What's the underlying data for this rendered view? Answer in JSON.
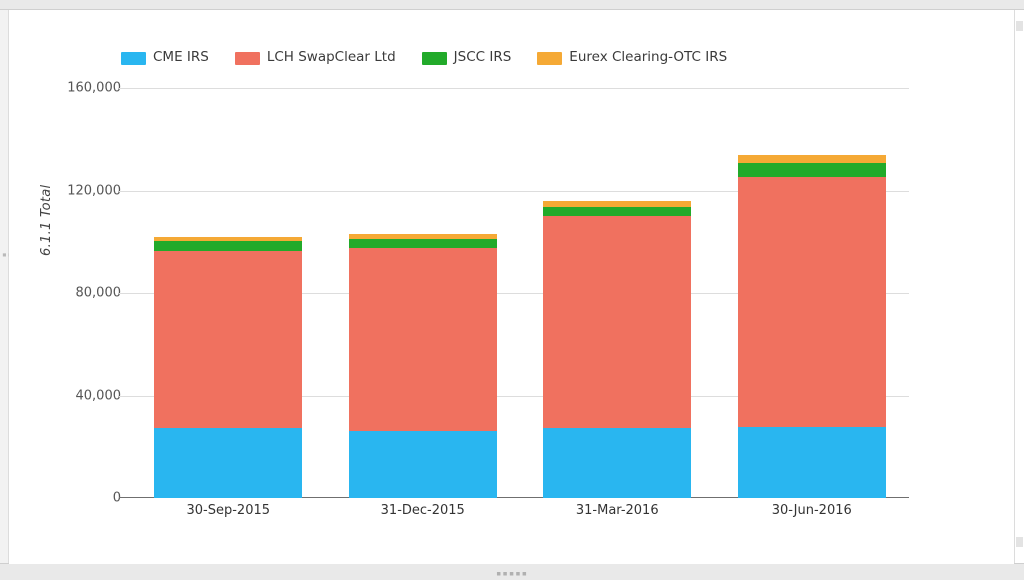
{
  "chart_data": {
    "type": "bar",
    "stacked": true,
    "title": "",
    "xlabel": "",
    "ylabel": "6.1.1 Total",
    "categories": [
      "30-Sep-2015",
      "31-Dec-2015",
      "31-Mar-2016",
      "30-Jun-2016"
    ],
    "ylim": [
      0,
      160000
    ],
    "y_ticks": [
      0,
      40000,
      80000,
      120000,
      160000
    ],
    "y_tick_labels": [
      "0",
      "40,000",
      "80,000",
      "120,000",
      "160,000"
    ],
    "grid": true,
    "legend_position": "top-left",
    "series": [
      {
        "name": "CME IRS",
        "color": "#29b6f0",
        "values": [
          27200,
          26000,
          27200,
          27600
        ]
      },
      {
        "name": "LCH SwapClear Ltd",
        "color": "#f0715f",
        "values": [
          69200,
          71600,
          82800,
          97600
        ]
      },
      {
        "name": "JSCC IRS",
        "color": "#22aa2a",
        "values": [
          4000,
          3600,
          3600,
          5600
        ]
      },
      {
        "name": "Eurex Clearing-OTC IRS",
        "color": "#f5a935",
        "values": [
          1600,
          2000,
          2400,
          3200
        ]
      }
    ],
    "totals": [
      102000,
      103200,
      116000,
      134000
    ]
  },
  "legend": {
    "items": [
      {
        "label": "CME IRS",
        "color": "#29b6f0"
      },
      {
        "label": "LCH SwapClear Ltd",
        "color": "#f0715f"
      },
      {
        "label": "JSCC IRS",
        "color": "#22aa2a"
      },
      {
        "label": "Eurex Clearing-OTC IRS",
        "color": "#f5a935"
      }
    ]
  },
  "axes": {
    "y_title": "6.1.1 Total",
    "y_labels": [
      "160,000",
      "120,000",
      "80,000",
      "40,000",
      "0"
    ],
    "x_labels": [
      "30-Sep-2015",
      "31-Dec-2015",
      "31-Mar-2016",
      "30-Jun-2016"
    ]
  },
  "frame": {
    "grip_glyph": "▪▪▪▪▪",
    "left_marks": "▪▪▪▪"
  }
}
